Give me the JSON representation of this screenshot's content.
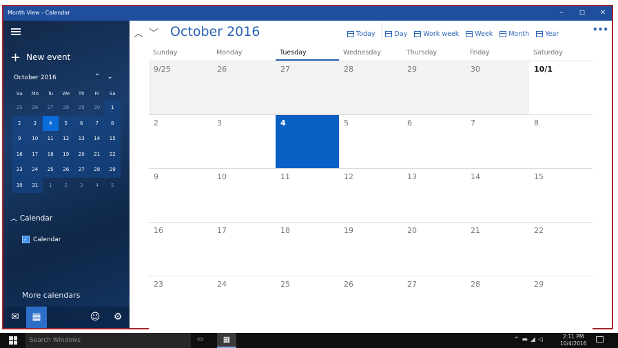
{
  "window": {
    "title": "Month View - Calendar",
    "controls": [
      "–",
      "◻",
      "✕"
    ]
  },
  "sidebar": {
    "new_event_label": "New event",
    "mini_calendar": {
      "title": "October 2016",
      "weekdays": [
        "Su",
        "Mo",
        "Tu",
        "We",
        "Th",
        "Fr",
        "Sa"
      ],
      "weeks": [
        [
          "25",
          "26",
          "27",
          "28",
          "29",
          "30",
          "1"
        ],
        [
          "2",
          "3",
          "4",
          "5",
          "6",
          "7",
          "8"
        ],
        [
          "9",
          "10",
          "11",
          "12",
          "13",
          "14",
          "15"
        ],
        [
          "16",
          "17",
          "18",
          "19",
          "20",
          "21",
          "22"
        ],
        [
          "23",
          "24",
          "25",
          "26",
          "27",
          "28",
          "29"
        ],
        [
          "30",
          "31",
          "1",
          "2",
          "3",
          "4",
          "5"
        ]
      ],
      "selected": "4"
    },
    "calendars_section_label": "Calendar",
    "calendar_item_label": "Calendar",
    "more_calendars_label": "More calendars"
  },
  "header": {
    "month_title": "October 2016",
    "toolbar": {
      "today": "Today",
      "day": "Day",
      "work_week": "Work week",
      "week": "Week",
      "month": "Month",
      "year": "Year",
      "more": "•••"
    }
  },
  "month_view": {
    "weekdays": [
      "Sunday",
      "Monday",
      "Tuesday",
      "Wednesday",
      "Thursday",
      "Friday",
      "Saturday"
    ],
    "today_column": "Tuesday",
    "weeks": [
      [
        "9/25",
        "26",
        "27",
        "28",
        "29",
        "30",
        "10/1"
      ],
      [
        "2",
        "3",
        "4",
        "5",
        "6",
        "7",
        "8"
      ],
      [
        "9",
        "10",
        "11",
        "12",
        "13",
        "14",
        "15"
      ],
      [
        "16",
        "17",
        "18",
        "19",
        "20",
        "21",
        "22"
      ],
      [
        "23",
        "24",
        "25",
        "26",
        "27",
        "28",
        "29"
      ]
    ]
  },
  "taskbar": {
    "search_placeholder": "Search Windows",
    "time": "2:11 PM",
    "date": "10/4/2016"
  },
  "colors": {
    "accent": "#2b63b6",
    "today_fill": "#0a5fc4",
    "titlebar": "#1f4e9c",
    "frame_highlight": "#a4262c"
  }
}
